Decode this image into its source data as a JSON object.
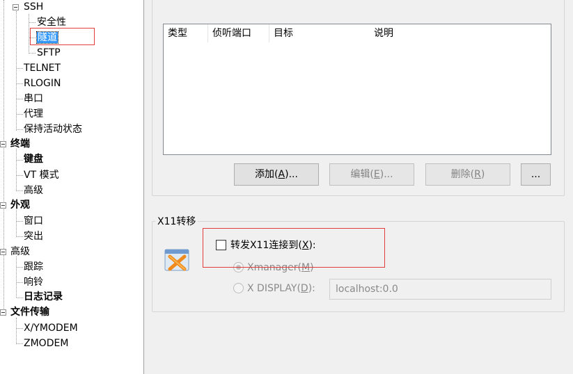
{
  "tree": {
    "ssh": "SSH",
    "security": "安全性",
    "tunnel": "隧道",
    "sftp": "SFTP",
    "telnet": "TELNET",
    "rlogin": "RLOGIN",
    "serial": "串口",
    "proxy": "代理",
    "keepalive": "保持活动状态",
    "terminal": "终端",
    "keyboard": "键盘",
    "vt_mode": "VT 模式",
    "terminal_advanced": "高级",
    "appearance": "外观",
    "window": "窗口",
    "highlight": "突出",
    "advanced": "高级",
    "trace": "跟踪",
    "bell": "响铃",
    "logging": "日志记录",
    "file_transfer": "文件传输",
    "xymodem": "X/YMODEM",
    "zmodem": "ZMODEM"
  },
  "tunnels": {
    "columns": [
      "类型",
      "侦听端口",
      "目标",
      "说明"
    ],
    "add_label": "添加(",
    "add_key": "A",
    "add_suffix": ")...",
    "edit_label": "编辑(",
    "edit_key": "E",
    "edit_suffix": ")...",
    "delete_label": "删除(",
    "delete_key": "R",
    "delete_suffix": ")",
    "more_label": "..."
  },
  "x11": {
    "group_title": "X11转移",
    "forward_label": "转发X11连接到(",
    "forward_key": "X",
    "forward_suffix": "):",
    "xmanager_label": "Xmanager(",
    "xmanager_key": "M",
    "xmanager_suffix": ")",
    "xdisplay_label": "X DISPLAY(",
    "xdisplay_key": "D",
    "xdisplay_suffix": "):",
    "xdisplay_value": "localhost:0.0"
  },
  "colors": {
    "selection": "#3399ff",
    "annotation": "#e23b3b"
  }
}
